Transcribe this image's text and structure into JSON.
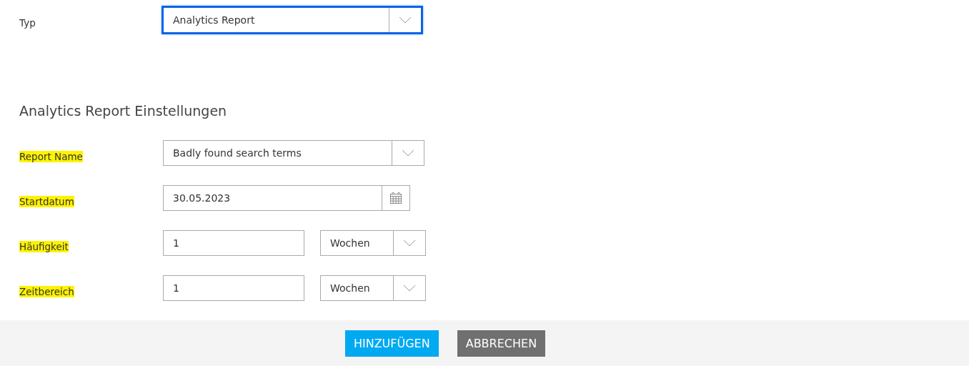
{
  "type_row": {
    "label": "Typ",
    "value": "Analytics Report",
    "focused": true
  },
  "section_title": "Analytics Report Einstellungen",
  "rows": [
    {
      "kind": "select",
      "label": "Report Name",
      "highlighted": true,
      "value": "Badly found search terms"
    },
    {
      "kind": "date",
      "label": "Startdatum",
      "highlighted": true,
      "value": "30.05.2023"
    },
    {
      "kind": "number_unit",
      "label": "Häufigkeit",
      "highlighted": true,
      "value": "1",
      "unit": "Wochen"
    },
    {
      "kind": "number_unit",
      "label": "Zeitbereich",
      "highlighted": true,
      "value": "1",
      "unit": "Wochen"
    }
  ],
  "buttons": [
    {
      "kind": "primary",
      "label": "HINZUFÜGEN"
    },
    {
      "kind": "secondary",
      "label": "ABBRECHEN"
    }
  ]
}
